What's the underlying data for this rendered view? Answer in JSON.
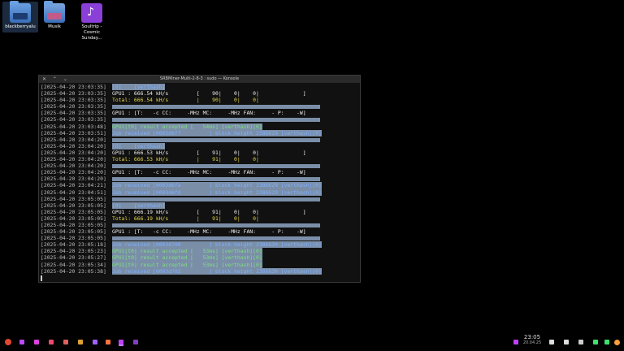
{
  "desktop": {
    "icons": [
      {
        "label": "blackberryalu",
        "icon": "folder-icon"
      },
      {
        "label": "Musik",
        "icon": "music-folder-icon"
      },
      {
        "label": "Soultrip - Cosmic Sunday...",
        "icon": "audio-file-icon"
      }
    ]
  },
  "window": {
    "title": "SRBMiner-Multi-2-8-3 : sudo — Konsole",
    "controls": "✕ ⌃ ⌄"
  },
  "terminal": {
    "lines": [
      {
        "ts": "[2025-04-20 23:03:35]",
        "text": "[0]    [verthash]",
        "style": "hl-blue"
      },
      {
        "ts": "[2025-04-20 23:03:35]",
        "text": "GPU1 : 666.54 kH/s         [    90|    0|    0|              ]",
        "style": "wht"
      },
      {
        "ts": "[2025-04-20 23:03:35]",
        "text": "Total: 666.54 kH/s         |    90|    0|    0|",
        "style": "yellow"
      },
      {
        "ts": "[2025-04-20 23:03:35]",
        "text": "",
        "style": "bar"
      },
      {
        "ts": "[2025-04-20 23:03:35]",
        "text": "GPU1 : [T:   -c CC:     -MHz MC:     -MHz FAN:     - P:    -W]",
        "style": "wht"
      },
      {
        "ts": "[2025-04-20 23:03:35]",
        "text": "",
        "style": "bar"
      },
      {
        "ts": "[2025-04-20 23:03:48]",
        "text": "GPU1[t0] result accepted [   54ms] [verthash][0]",
        "style": "green"
      },
      {
        "ts": "[2025-04-20 23:03:51]",
        "text": "Job received [0003d6f7         ] block height 2386629 [verthash][0]",
        "style": "hl-blue"
      },
      {
        "ts": "[2025-04-20 23:04:20]",
        "text": "",
        "style": "bar"
      },
      {
        "ts": "[2025-04-20 23:04:20]",
        "text": "[0]    [verthash]",
        "style": "hl-blue"
      },
      {
        "ts": "[2025-04-20 23:04:20]",
        "text": "GPU1 : 666.53 kH/s         [    91|    0|    0|              ]",
        "style": "wht"
      },
      {
        "ts": "[2025-04-20 23:04:20]",
        "text": "Total: 666.53 kH/s         |    91|    0|    0|",
        "style": "yellow"
      },
      {
        "ts": "[2025-04-20 23:04:20]",
        "text": "",
        "style": "bar"
      },
      {
        "ts": "[2025-04-20 23:04:20]",
        "text": "GPU1 : [T:   -c CC:     -MHz MC:     -MHz FAN:     - P:    -W]",
        "style": "wht"
      },
      {
        "ts": "[2025-04-20 23:04:20]",
        "text": "",
        "style": "bar"
      },
      {
        "ts": "[2025-04-20 23:04:21]",
        "text": "Job received [0003d6fa         ] block height 2386629 [verthash][0]",
        "style": "hl-blue"
      },
      {
        "ts": "[2025-04-20 23:04:51]",
        "text": "Job received [0003d6fd         ] block height 2386629 [verthash][0]",
        "style": "hl-blue"
      },
      {
        "ts": "[2025-04-20 23:05:05]",
        "text": "",
        "style": "bar"
      },
      {
        "ts": "[2025-04-20 23:05:05]",
        "text": "[0]    [verthash]",
        "style": "hl-blue"
      },
      {
        "ts": "[2025-04-20 23:05:05]",
        "text": "GPU1 : 666.19 kH/s         [    91|    0|    0|              ]",
        "style": "wht"
      },
      {
        "ts": "[2025-04-20 23:05:05]",
        "text": "Total: 666.19 kH/s         |    91|    0|    0|",
        "style": "yellow"
      },
      {
        "ts": "[2025-04-20 23:05:05]",
        "text": "",
        "style": "bar"
      },
      {
        "ts": "[2025-04-20 23:05:05]",
        "text": "GPU1 : [T:   -c CC:     -MHz MC:     -MHz FAN:     - P:    -W]",
        "style": "wht"
      },
      {
        "ts": "[2025-04-20 23:05:05]",
        "text": "",
        "style": "bar"
      },
      {
        "ts": "[2025-04-20 23:05:18]",
        "text": "Job received [0003d700         ] block height 2386630 [verthash][0]",
        "style": "hl-blue"
      },
      {
        "ts": "[2025-04-20 23:05:23]",
        "text": "GPU1[t0] result accepted [   53ms] [verthash][0]",
        "style": "green"
      },
      {
        "ts": "[2025-04-20 23:05:27]",
        "text": "GPU1[t0] result accepted [   53ms] [verthash][0]",
        "style": "green"
      },
      {
        "ts": "[2025-04-20 23:05:34]",
        "text": "GPU1[t0] result accepted [   53ms] [verthash][0]",
        "style": "green"
      },
      {
        "ts": "[2025-04-20 23:05:38]",
        "text": "Job received [0003d702         ] block height 2386630 [verthash][0]",
        "style": "hl-blue"
      }
    ]
  },
  "taskbar": {
    "time": "23:05",
    "date": "20.04.25",
    "left_icons": [
      "application-launcher-icon",
      "app-icon",
      "app-icon",
      "app-icon",
      "app-icon",
      "app-icon",
      "app-icon",
      "terminal-icon",
      "app-icon"
    ],
    "tray_icons": [
      "bluetooth-icon",
      "volume-icon",
      "wifi-icon",
      "battery-icon",
      "power-icon"
    ]
  },
  "colors": {
    "accent": "#7a8ea8",
    "green_text": "#7fe07f",
    "yellow_text": "#e6d84a",
    "blue_text": "#7fb0ff"
  }
}
